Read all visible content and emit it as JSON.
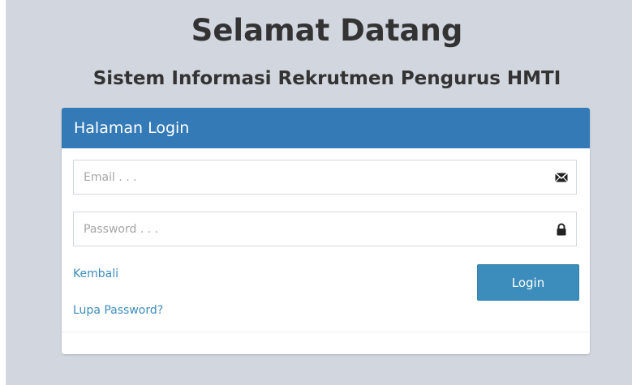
{
  "heading": {
    "title": "Selamat Datang",
    "subtitle": "Sistem Informasi Rekrutmen Pengurus HMTI"
  },
  "login_panel": {
    "header": "Halaman Login",
    "email": {
      "placeholder": "Email . . .",
      "value": "",
      "icon": "envelope-icon"
    },
    "password": {
      "placeholder": "Password . . .",
      "value": "",
      "icon": "lock-icon"
    },
    "back_link": "Kembali",
    "forgot_link": "Lupa Password?",
    "login_button": "Login"
  },
  "colors": {
    "background": "#d2d6de",
    "header": "#337ab7",
    "button": "#3c8dbc",
    "link": "#3c8dbc"
  }
}
